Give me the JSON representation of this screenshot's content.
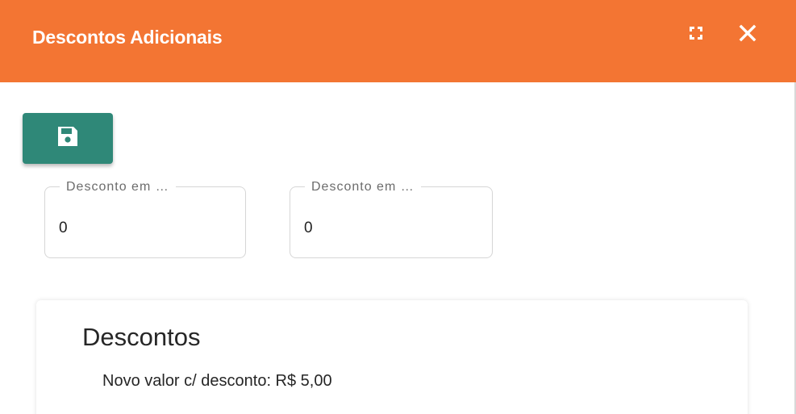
{
  "dialog": {
    "title": "Descontos Adicionais",
    "header_color": "#f37533",
    "icons": {
      "fullscreen": "fullscreen-icon",
      "close": "close-icon"
    }
  },
  "toolbar": {
    "save_icon": "save-icon",
    "save_button_color": "#2f8878"
  },
  "fields": [
    {
      "label": "Desconto em …",
      "value": "0"
    },
    {
      "label": "Desconto em …",
      "value": "0"
    }
  ],
  "summary": {
    "title": "Descontos",
    "new_value_label": "Novo valor c/ desconto: R$ 5,00"
  }
}
